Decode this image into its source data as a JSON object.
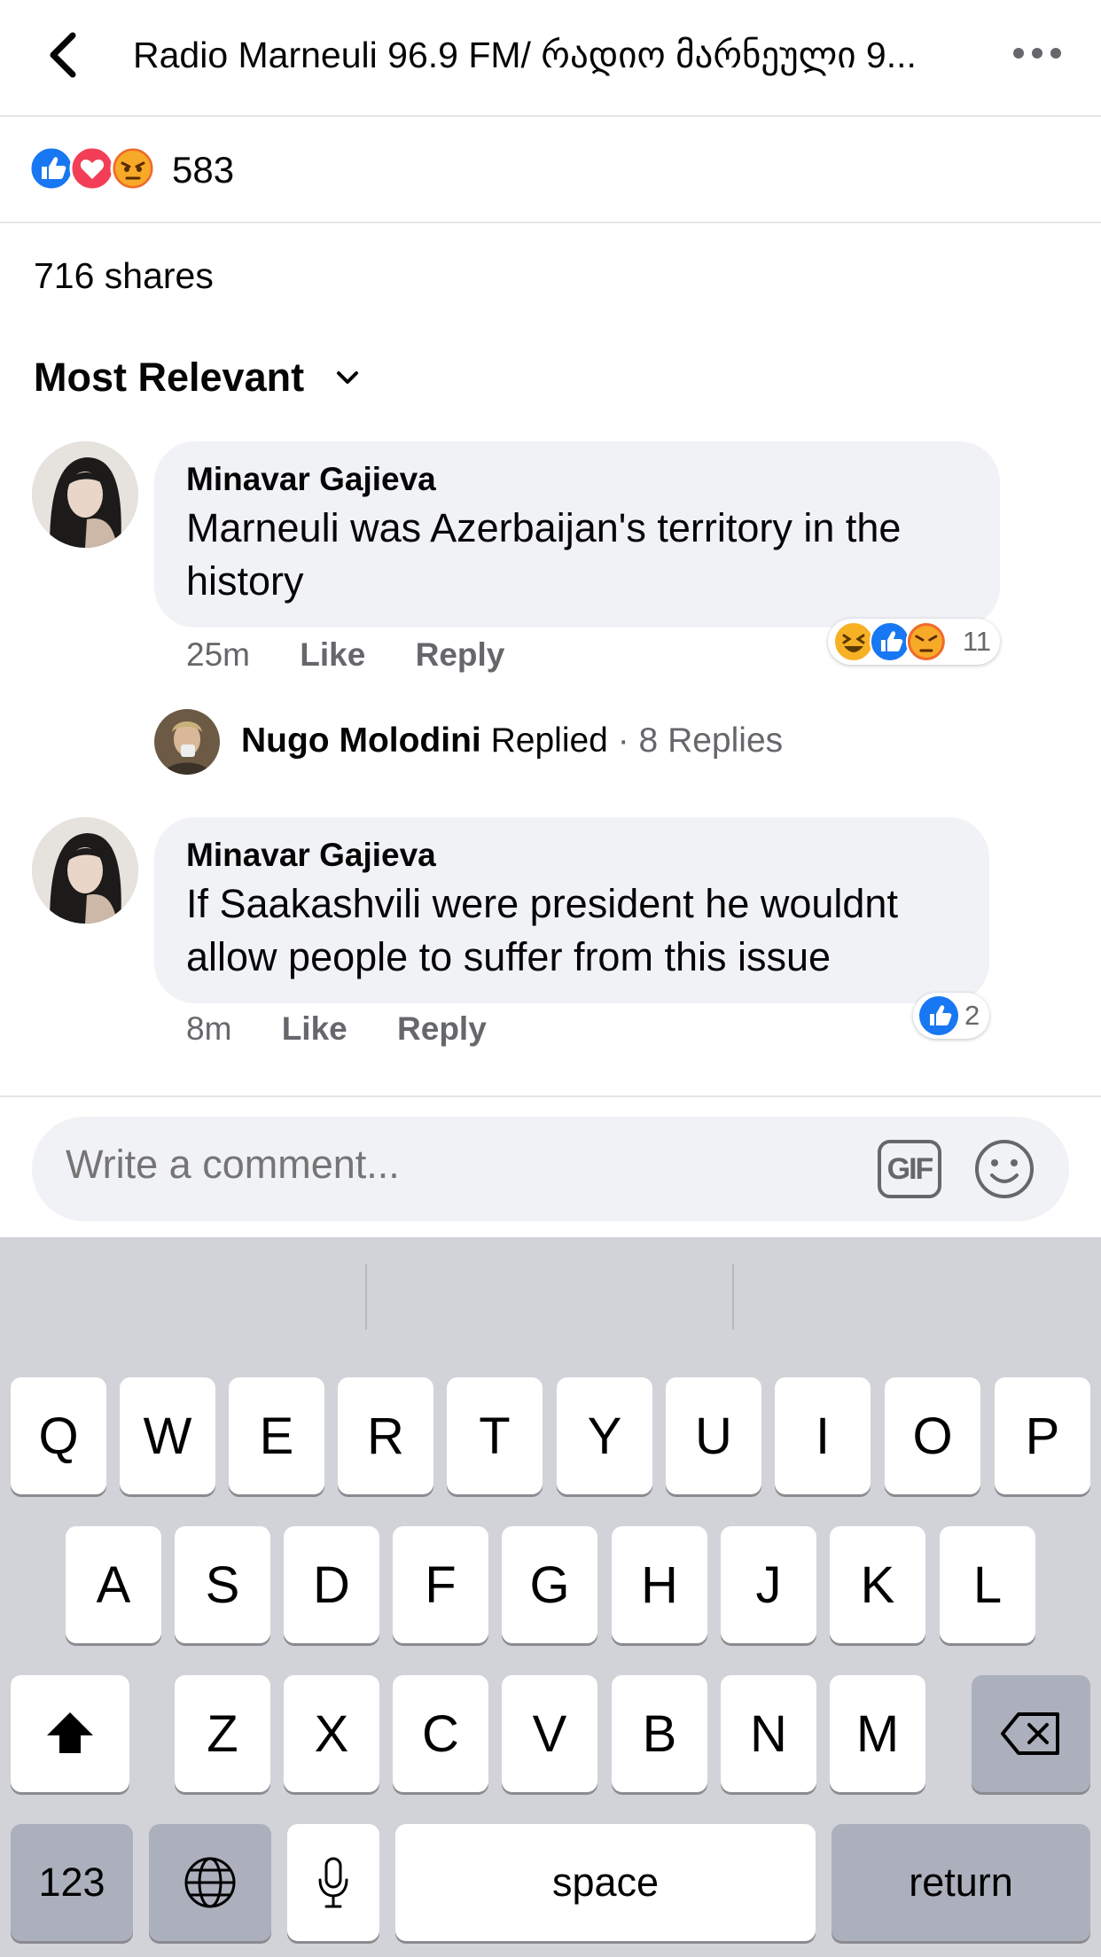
{
  "header": {
    "title": "Radio Marneuli 96.9 FM/ რადიო მარნეული 9...",
    "back_icon": "chevron-left-icon",
    "more_icon": "more-horizontal-icon"
  },
  "post": {
    "reactions": [
      "like",
      "love",
      "angry"
    ],
    "reaction_count": "583",
    "shares": "716 shares"
  },
  "sort": {
    "label": "Most Relevant",
    "icon": "chevron-down-icon"
  },
  "comments": [
    {
      "author": "Minavar Gajieva",
      "text": "Marneuli was Azerbaijan's territory in the history",
      "time": "25m",
      "like": "Like",
      "reply": "Reply",
      "reactions": [
        "haha",
        "like",
        "angry"
      ],
      "reaction_count": "11"
    },
    {
      "author": "Minavar Gajieva",
      "text": "If Saakashvili were president he wouldnt allow people to suffer from this issue",
      "time": "8m",
      "like": "Like",
      "reply": "Reply",
      "reactions": [
        "like"
      ],
      "reaction_count": "2"
    }
  ],
  "replies_summary": {
    "name": "Nugo Molodini",
    "action": "Replied",
    "count": "· 8 Replies"
  },
  "composer": {
    "placeholder": "Write a comment...",
    "gif_label": "GIF",
    "emoji_icon": "smiley-icon"
  },
  "keyboard": {
    "row1": [
      "Q",
      "W",
      "E",
      "R",
      "T",
      "Y",
      "U",
      "I",
      "O",
      "P"
    ],
    "row2": [
      "A",
      "S",
      "D",
      "F",
      "G",
      "H",
      "J",
      "K",
      "L"
    ],
    "row3": [
      "Z",
      "X",
      "C",
      "V",
      "B",
      "N",
      "M"
    ],
    "numbers_label": "123",
    "space_label": "space",
    "return_label": "return"
  },
  "colors": {
    "like_blue": "#1877f2",
    "love_red": "#f33e58",
    "angry_orange": "#f7b125",
    "bubble_gray": "#f0f2f5",
    "keyboard_bg": "#d1d3d9"
  }
}
